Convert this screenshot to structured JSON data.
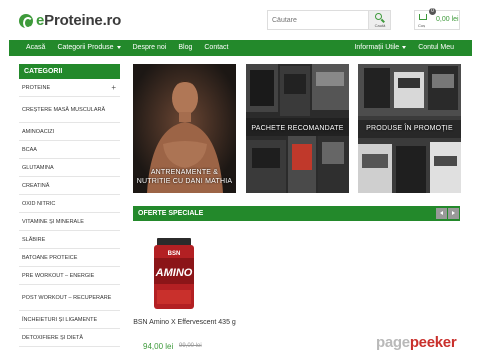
{
  "header": {
    "logo_prefix": "e",
    "logo_rest": "Proteine.ro",
    "search_placeholder": "Căutare",
    "search_button_label": "Caută",
    "cart_count": "0",
    "cart_label": "Coș",
    "cart_total": "0,00 lei"
  },
  "nav": {
    "items": [
      "Acasă",
      "Categorii Produse",
      "Despre noi",
      "Blog",
      "Contact"
    ],
    "right_items": [
      "Informații Utile",
      "Contul Meu"
    ]
  },
  "sidebar": {
    "title": "CATEGORII",
    "items": [
      "PROTEINE",
      "CREȘTERE MASĂ MUSCULARĂ",
      "AMINOACIZI",
      "BCAA",
      "GLUTAMINA",
      "CREATINĂ",
      "OXID NITRIC",
      "VITAMINE ȘI MINERALE",
      "SLĂBIRE",
      "BATOANE PROTEICE",
      "PRE WORKOUT – ENERGIE",
      "POST WORKOUT – RECUPERARE",
      "ÎNCHEIETURI ȘI LIGAMENTE",
      "DETOXIFIERE ȘI DIETĂ"
    ]
  },
  "banners": [
    {
      "caption": "ANTRENAMENTE & NUTRITIE CU DANI MATHIA"
    },
    {
      "caption": "PACHETE RECOMANDATE"
    },
    {
      "caption": "PRODUSE ÎN PROMOȚIE"
    }
  ],
  "offers": {
    "title": "OFERTE SPECIALE",
    "product": {
      "name": "BSN Amino X Effervescent 435 g",
      "price": "94,00 lei",
      "old_price": "99,00 lei",
      "label_brand": "BSN",
      "label_name": "AMINO"
    }
  },
  "watermark": {
    "part1": "page",
    "part2": "peeker"
  }
}
